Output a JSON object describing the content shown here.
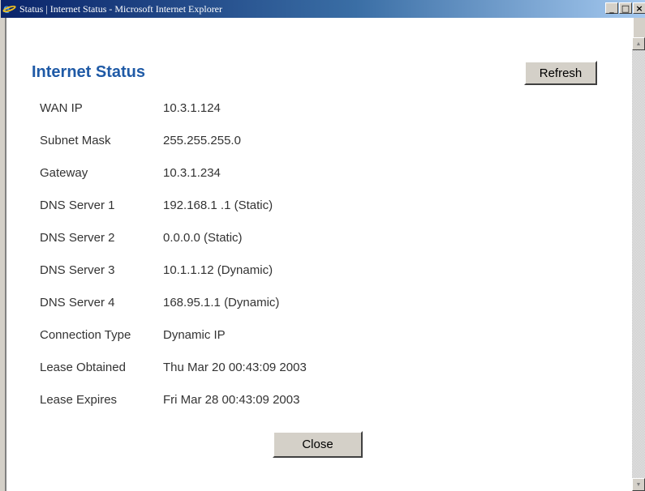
{
  "window": {
    "title": "Status | Internet Status - Microsoft Internet Explorer",
    "minimize_glyph": "_",
    "maximize_glyph": "□",
    "close_glyph": "×",
    "app_icon": "internet-explorer-icon"
  },
  "page": {
    "title": "Internet Status",
    "refresh_label": "Refresh",
    "close_label": "Close"
  },
  "status_rows": [
    {
      "label": "WAN IP",
      "value": "10.3.1.124"
    },
    {
      "label": "Subnet Mask",
      "value": "255.255.255.0"
    },
    {
      "label": "Gateway",
      "value": "10.3.1.234"
    },
    {
      "label": "DNS Server 1",
      "value": "192.168.1 .1 (Static)"
    },
    {
      "label": "DNS Server 2",
      "value": "0.0.0.0 (Static)"
    },
    {
      "label": "DNS Server 3",
      "value": "10.1.1.12 (Dynamic)"
    },
    {
      "label": "DNS Server 4",
      "value": "168.95.1.1 (Dynamic)"
    },
    {
      "label": "Connection Type",
      "value": "Dynamic IP"
    },
    {
      "label": "Lease Obtained",
      "value": "Thu Mar 20 00:43:09 2003"
    },
    {
      "label": "Lease Expires",
      "value": "Fri Mar 28 00:43:09 2003"
    }
  ],
  "colors": {
    "title_color": "#1f5aa6",
    "titlebar_start": "#0a246a",
    "titlebar_end": "#a6caf0"
  }
}
